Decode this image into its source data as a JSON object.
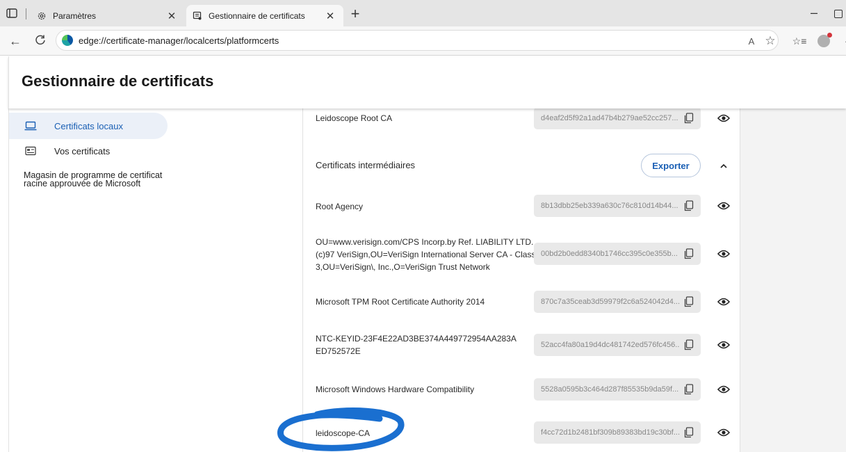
{
  "tabs": [
    {
      "title": "Paramètres",
      "icon": "gear-icon",
      "close": "✕"
    },
    {
      "title": "Gestionnaire de certificats",
      "icon": "certificate-icon",
      "close": "✕"
    }
  ],
  "new_tab": "+",
  "window": {
    "minimize": "–"
  },
  "toolbar": {
    "back": "←",
    "refresh": "C",
    "url": "edge://certificate-manager/localcerts/platformcerts",
    "read_aloud": "A",
    "favorite": "☆",
    "favorites": "☆≡",
    "more": "·"
  },
  "page": {
    "title": "Gestionnaire de certificats"
  },
  "sidebar": {
    "items": [
      {
        "label": "Certificats locaux",
        "icon": "laptop-icon",
        "selected": true
      },
      {
        "label": "Vos certificats",
        "icon": "id-card-icon",
        "selected": false
      }
    ],
    "store_link": "Magasin de programme de certificat racine approuvée de Microsoft"
  },
  "main": {
    "top_cert": {
      "name": "Leidoscope Root CA",
      "hash": "d4eaf2d5f92a1ad47b4b279ae52cc257..."
    },
    "intermediate": {
      "title": "Certificats intermédiaires",
      "export_label": "Exporter",
      "certs": [
        {
          "name": "Root Agency",
          "hash": "8b13dbb25eb339a630c76c810d14b44..."
        },
        {
          "name": "OU=www.verisign.com/CPS Incorp.by Ref. LIABILITY LTD.(c)97 VeriSign,OU=VeriSign International Server CA - Class 3,OU=VeriSign\\, Inc.,O=VeriSign Trust Network",
          "hash": "00bd2b0edd8340b1746cc395c0e355b..."
        },
        {
          "name": "Microsoft TPM Root Certificate Authority 2014",
          "hash": "870c7a35ceab3d59979f2c6a524042d4..."
        },
        {
          "name": "NTC-KEYID-23F4E22AD3BE374A449772954AA283AED752572E",
          "hash": "52acc4fa80a19d4dc481742ed576fc456..."
        },
        {
          "name": "Microsoft Windows Hardware Compatibility",
          "hash": "5528a0595b3c464d287f85535b9da59f..."
        },
        {
          "name": "leidoscope-CA",
          "hash": "f4cc72d1b2481bf309b89383bd19c30bf..."
        }
      ]
    }
  },
  "colors": {
    "accent": "#1a5fb4",
    "selected_bg": "#ebf0f8",
    "marker": "#1a6fd0"
  }
}
